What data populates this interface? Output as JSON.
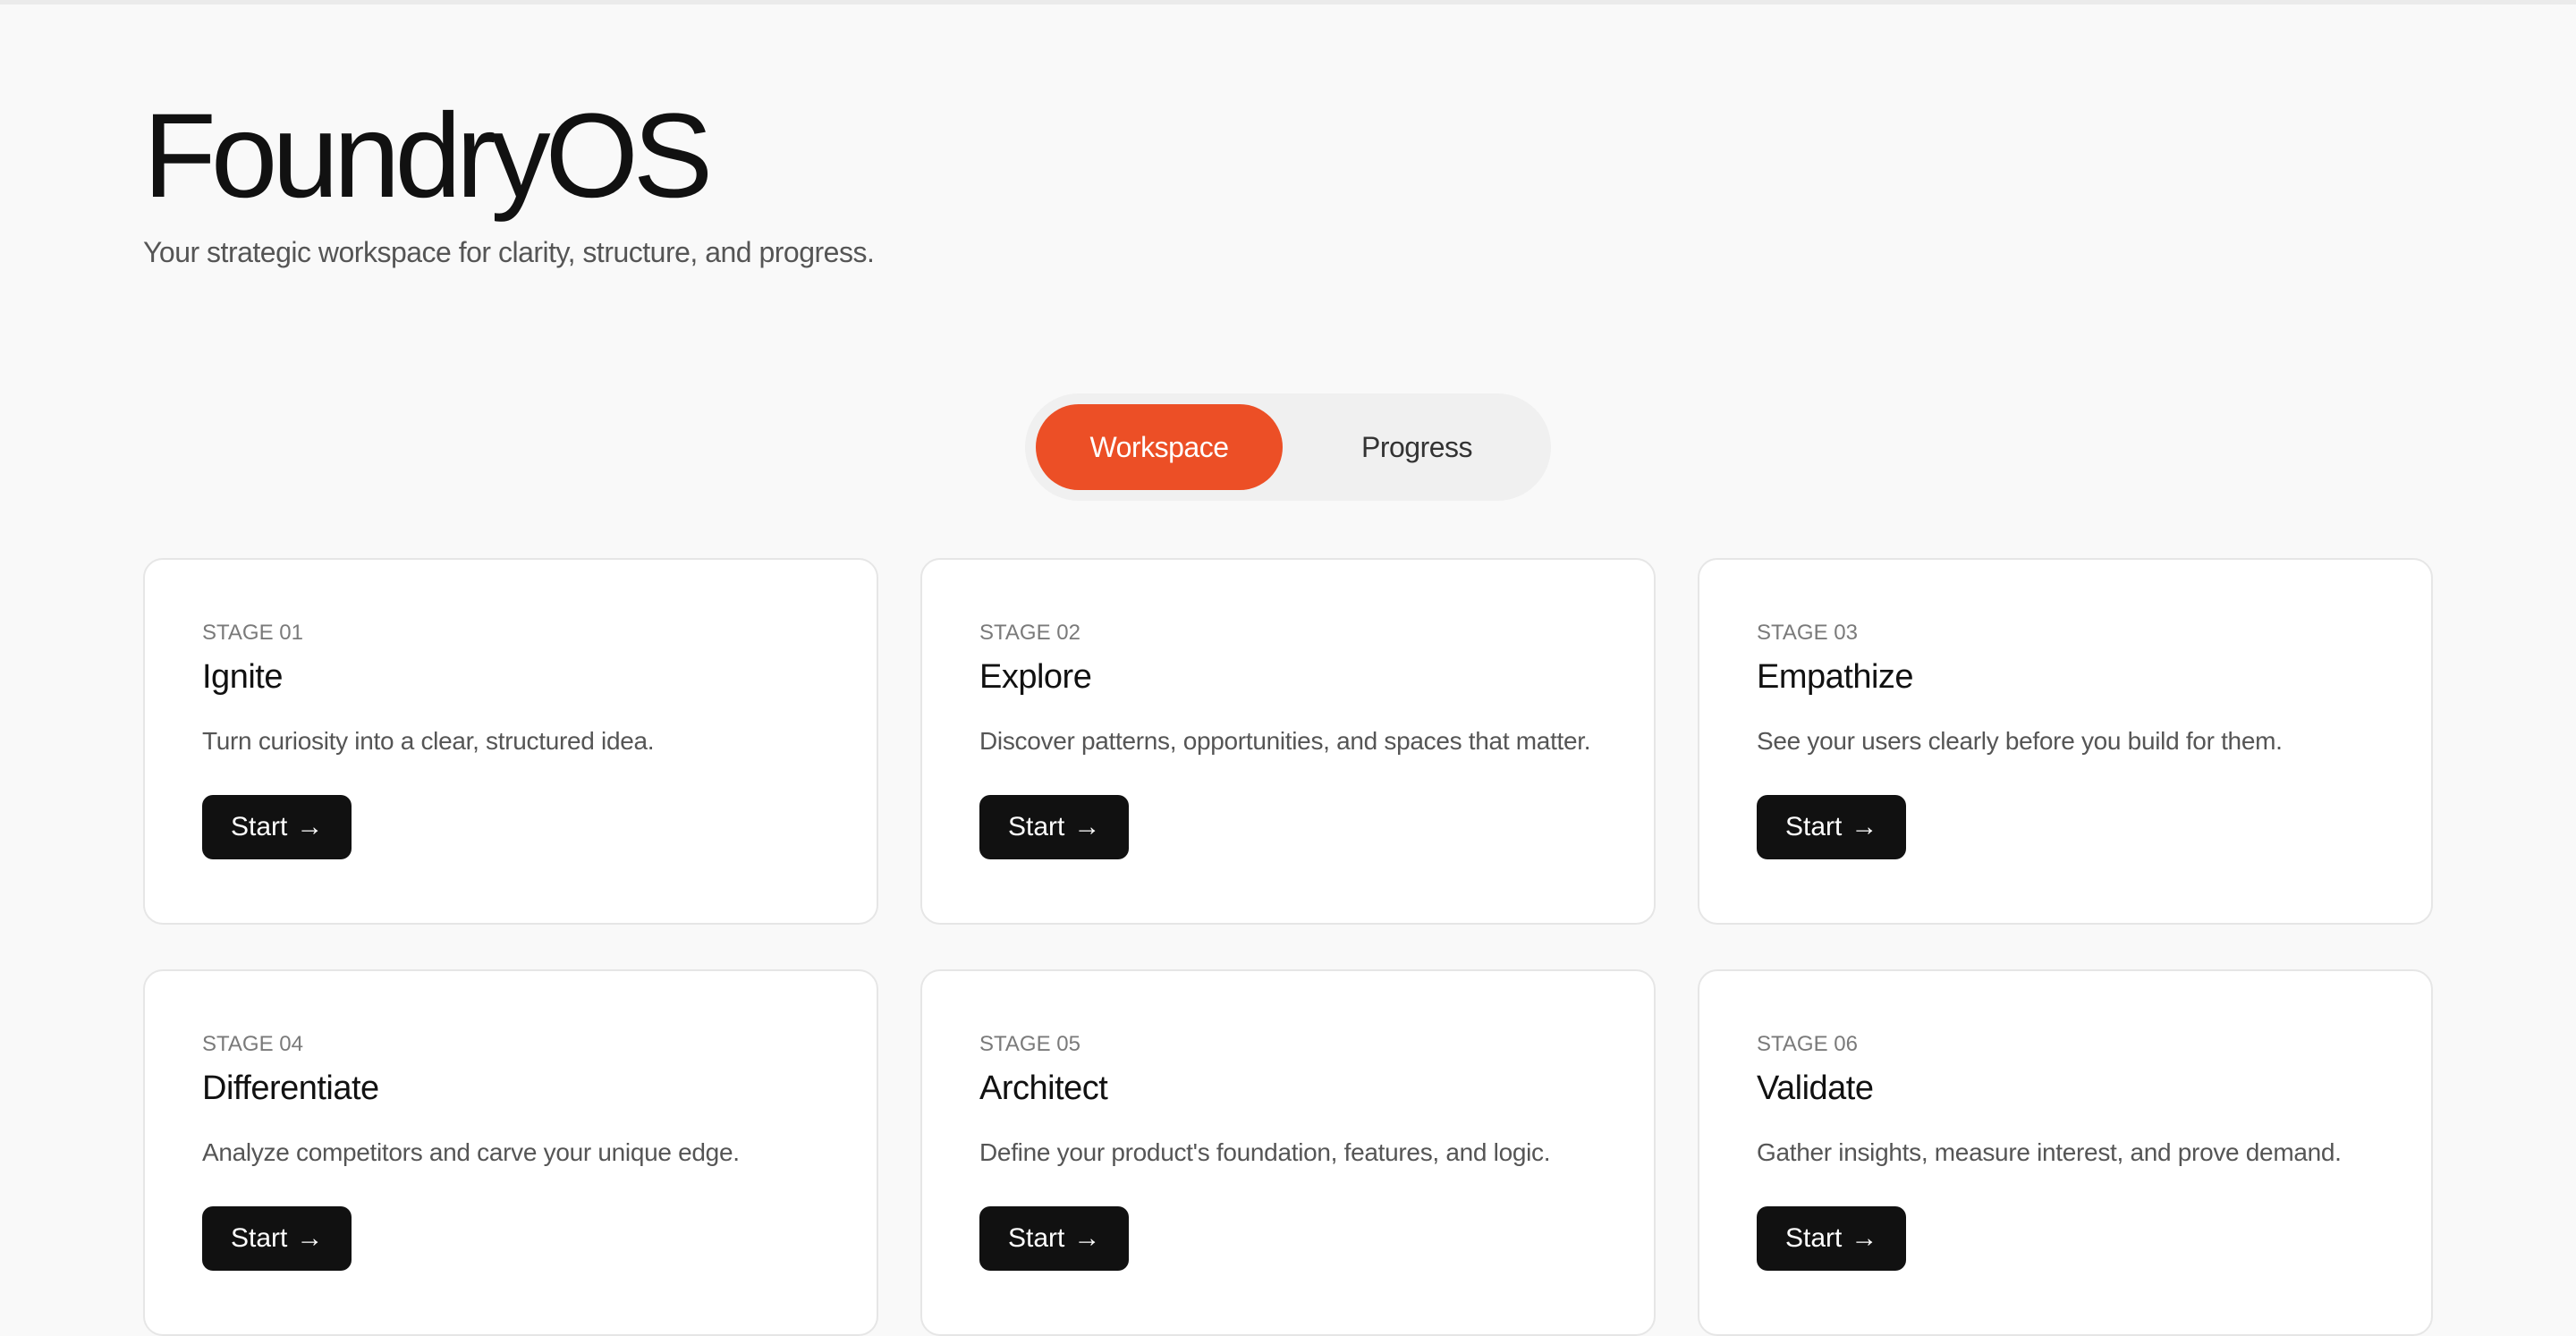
{
  "header": {
    "title": "FoundryOS",
    "subtitle": "Your strategic workspace for clarity, structure, and progress."
  },
  "toggle": {
    "workspace_label": "Workspace",
    "progress_label": "Progress",
    "active": "Workspace",
    "accent_color": "#ec4f26"
  },
  "stages": [
    {
      "label": "STAGE 01",
      "title": "Ignite",
      "description": "Turn curiosity into a clear, structured idea.",
      "button_label": "Start",
      "button_icon": "arrow-right-icon"
    },
    {
      "label": "STAGE 02",
      "title": "Explore",
      "description": "Discover patterns, opportunities, and spaces that matter.",
      "button_label": "Start",
      "button_icon": "arrow-right-icon"
    },
    {
      "label": "STAGE 03",
      "title": "Empathize",
      "description": "See your users clearly before you build for them.",
      "button_label": "Start",
      "button_icon": "arrow-right-icon"
    },
    {
      "label": "STAGE 04",
      "title": "Differentiate",
      "description": "Analyze competitors and carve your unique edge.",
      "button_label": "Start",
      "button_icon": "arrow-right-icon"
    },
    {
      "label": "STAGE 05",
      "title": "Architect",
      "description": "Define your product's foundation, features, and logic.",
      "button_label": "Start",
      "button_icon": "arrow-right-icon"
    },
    {
      "label": "STAGE 06",
      "title": "Validate",
      "description": "Gather insights, measure interest, and prove demand.",
      "button_label": "Start",
      "button_icon": "arrow-right-icon"
    }
  ]
}
